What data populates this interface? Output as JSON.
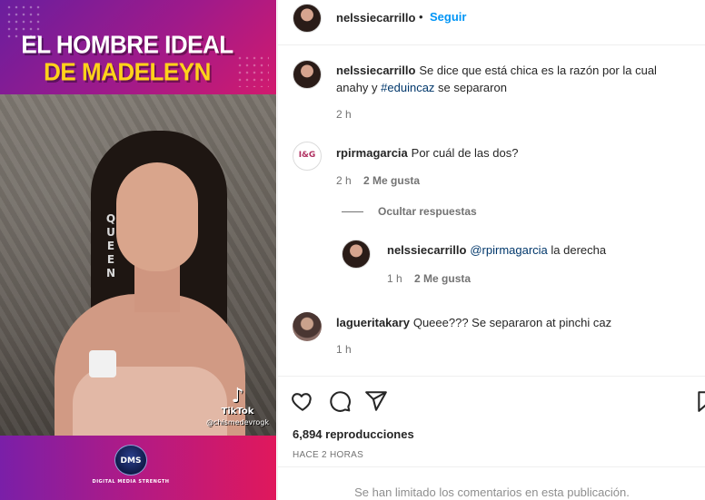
{
  "media": {
    "headline_line1": "EL HOMBRE IDEAL",
    "headline_line2": "DE MADELEYN",
    "necklace_text": "QUEEN",
    "tiktok_brand": "TikTok",
    "tiktok_handle": "@chismedevrogk",
    "logo_text": "DMS",
    "logo_caption": "DIGITAL MEDIA STRENGTH",
    "colors": {
      "headline_white": "#ffffff",
      "headline_yellow": "#ffd21a",
      "bg_purple": "#7a1fa8",
      "bg_pink": "#e0185c"
    }
  },
  "header": {
    "username": "nelssiecarrillo",
    "separator": "•",
    "follow_label": "Seguir",
    "avatar_icon": "profile-avatar"
  },
  "caption": {
    "username": "nelssiecarrillo",
    "text_before": "Se dice que está chica es la razón por la cual anahy y ",
    "hashtag": "#eduincaz",
    "text_after": " se separaron",
    "time": "2 h"
  },
  "comments": [
    {
      "username": "rpirmagarcia",
      "text": "Por cuál de las dos?",
      "time": "2 h",
      "likes": "2 Me gusta",
      "avatar_text": "I&G"
    },
    {
      "username": "laguerit akary",
      "text": "Queee??? Se separaron at pinchi caz",
      "time": "1 h"
    }
  ],
  "replies_toggle": "Ocultar respuestas",
  "reply": {
    "username": "nelssiecarrillo",
    "mention": "@rpirmagarcia",
    "text": " la derecha",
    "time": "1 h",
    "likes": "2 Me gusta"
  },
  "actions": {
    "icons": [
      "heart-icon",
      "comment-icon",
      "share-icon",
      "bookmark-icon"
    ],
    "views": "6,894 reproducciones",
    "posted": "HACE 2 HORAS",
    "comments_limited": "Se han limitado los comentarios en esta publicación."
  },
  "colors": {
    "link_blue": "#0095f6",
    "hashtag_blue": "#00376b",
    "muted_gray": "#737373"
  }
}
